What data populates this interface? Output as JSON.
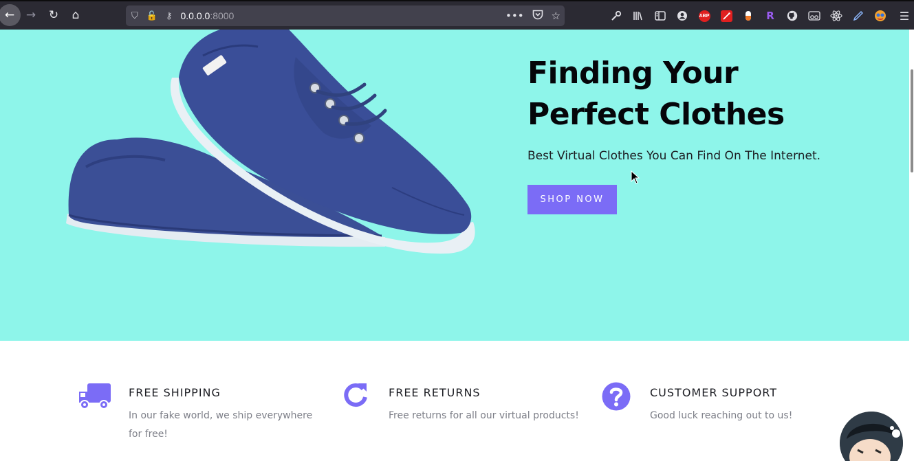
{
  "browser": {
    "url_host": "0.0.0.0",
    "url_port": ":8000",
    "nav": {
      "back": "←",
      "forward": "→",
      "reload": "↻",
      "home": "⌂"
    },
    "url_icons": {
      "shield": "⛉",
      "insecure": "🔓",
      "key": "⚷"
    },
    "url_actions": {
      "more": "•••",
      "pocket": "◡",
      "bookmark": "☆"
    },
    "toolbar": [
      {
        "name": "wrench-icon",
        "glyph": "🔧"
      },
      {
        "name": "library-icon",
        "glyph": "Ⅲ"
      },
      {
        "name": "reader-view-icon",
        "glyph": "▥"
      },
      {
        "name": "account-icon",
        "glyph": "◉"
      },
      {
        "name": "adblock-plus-icon",
        "text": "ABP",
        "color": "#e02020"
      },
      {
        "name": "magic-wand-icon",
        "glyph": "✦",
        "color": "#e02020"
      },
      {
        "name": "pill-icon",
        "glyph": "●",
        "color": "#f07a2a"
      },
      {
        "name": "r-extension-icon",
        "glyph": "R",
        "color": "#8a50d8"
      },
      {
        "name": "github-icon",
        "glyph": "●"
      },
      {
        "name": "glasses-icon",
        "glyph": "∞"
      },
      {
        "name": "react-icon",
        "glyph": "⚛"
      },
      {
        "name": "pen-icon",
        "glyph": "✎"
      },
      {
        "name": "colorful-extension-icon",
        "glyph": "◍"
      }
    ],
    "menu": "☰"
  },
  "hero": {
    "title_line1": "Finding Your",
    "title_line2": "Perfect Clothes",
    "subtitle": "Best Virtual Clothes You Can Find On The Internet.",
    "button_label": "SHOP NOW",
    "background": "#8ef5ea",
    "accent": "#7b6cf6"
  },
  "features": [
    {
      "title": "FREE SHIPPING",
      "desc_line1": "In our fake world, we ship everywhere",
      "desc_line2": "for free!",
      "icon": "truck-icon"
    },
    {
      "title": "FREE RETURNS",
      "desc_line1": "Free returns for all our virtual products!",
      "icon": "refresh-icon"
    },
    {
      "title": "CUSTOMER SUPPORT",
      "desc_line1": "Good luck reaching out to us!",
      "icon": "question-circle-icon"
    }
  ]
}
